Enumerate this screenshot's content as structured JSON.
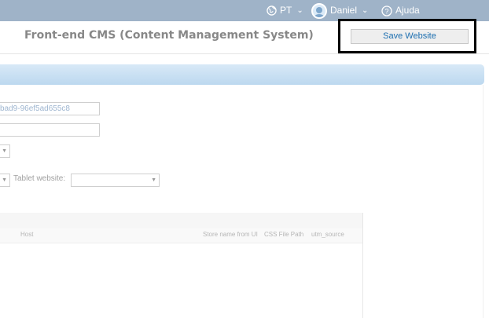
{
  "topbar": {
    "language": "PT",
    "user_name": "Daniel",
    "help_label": "Ajuda"
  },
  "header": {
    "title": "Front-end CMS (Content Management System)",
    "save_label": "Save Website"
  },
  "form": {
    "id_value": "bad9-96ef5ad655c8",
    "empty_value": "",
    "tablet_label": "Tablet website:",
    "tablet_value": ""
  },
  "grid": {
    "columns": [
      "Host",
      "Store name from UI",
      "CSS File Path",
      "utm_source"
    ]
  },
  "colors": {
    "topbar": "#9fb3c8",
    "banner": "#c9e0f2",
    "save_text": "#1d6fb0"
  }
}
